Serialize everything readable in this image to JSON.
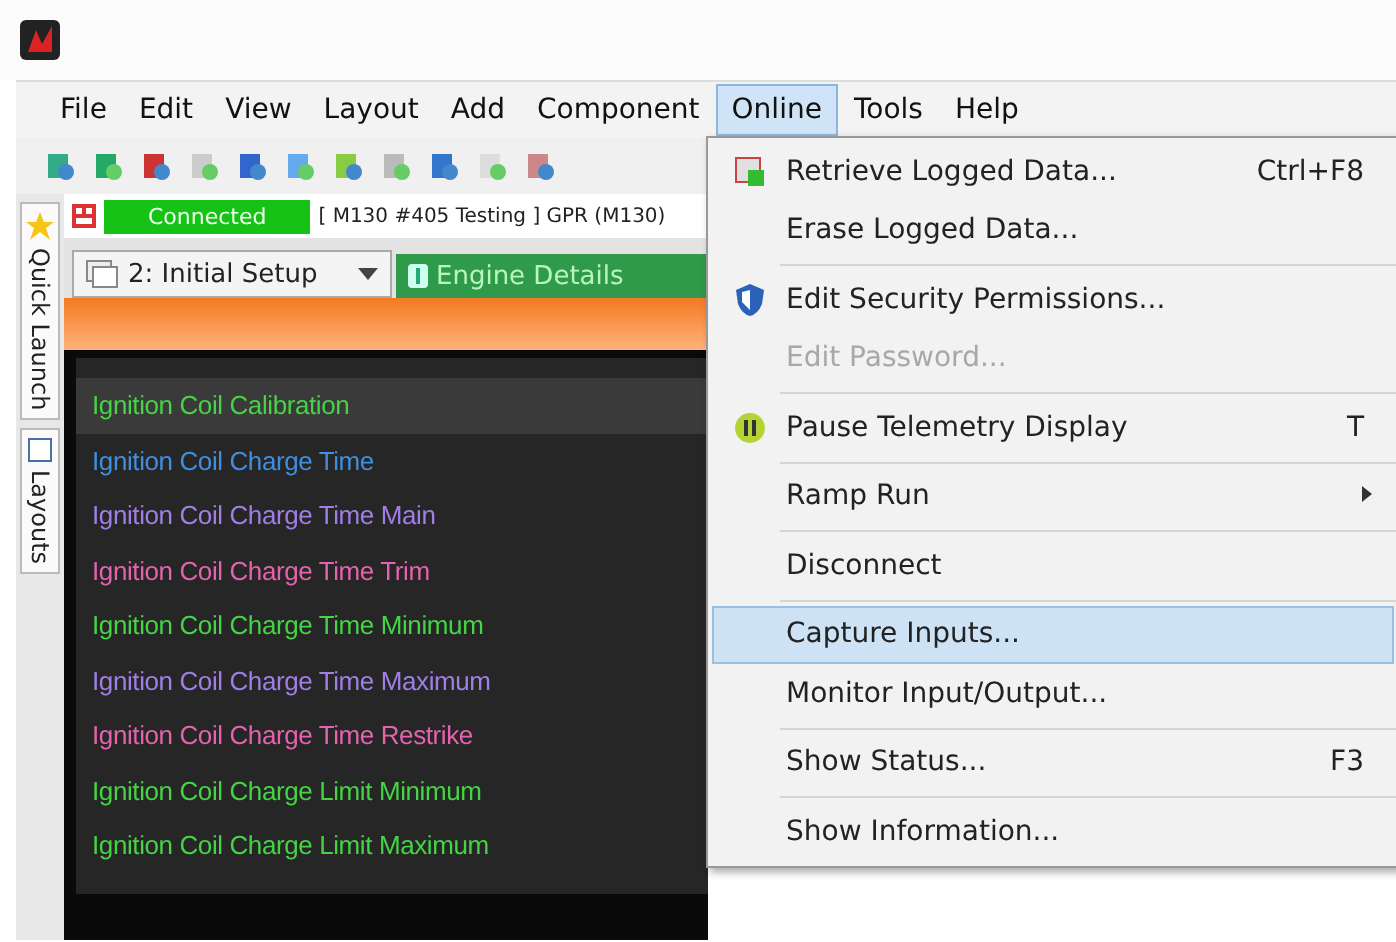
{
  "menu_bar": [
    {
      "label": "File",
      "selected": false
    },
    {
      "label": "Edit",
      "selected": false
    },
    {
      "label": "View",
      "selected": false
    },
    {
      "label": "Layout",
      "selected": false
    },
    {
      "label": "Add",
      "selected": false
    },
    {
      "label": "Component",
      "selected": false
    },
    {
      "label": "Online",
      "selected": true
    },
    {
      "label": "Tools",
      "selected": false
    },
    {
      "label": "Help",
      "selected": false
    }
  ],
  "side_tabs": [
    {
      "label": "Quick Launch",
      "kind": "star"
    },
    {
      "label": "Layouts",
      "kind": "square"
    }
  ],
  "connection": {
    "status": "Connected",
    "connected": true,
    "device": "[ M130 #405 Testing ]  GPR (M130)"
  },
  "workbook": {
    "value": "2: Initial Setup"
  },
  "tabs": [
    {
      "label": "Engine Details",
      "selected": true
    }
  ],
  "channels": [
    {
      "name": "Ignition Coil Calibration",
      "color": "#44d444",
      "selected": true
    },
    {
      "name": "Ignition Coil Charge Time",
      "color": "#3f8fe0",
      "selected": false
    },
    {
      "name": "Ignition Coil Charge Time Main",
      "color": "#a07ee6",
      "selected": false
    },
    {
      "name": "Ignition Coil Charge Time Trim",
      "color": "#e463ae",
      "selected": false
    },
    {
      "name": "Ignition Coil Charge Time Minimum",
      "color": "#44d444",
      "selected": false
    },
    {
      "name": "Ignition Coil Charge Time Maximum",
      "color": "#a07ee6",
      "selected": false
    },
    {
      "name": "Ignition Coil Charge Time Restrike",
      "color": "#e463ae",
      "selected": false
    },
    {
      "name": "Ignition Coil Charge Limit Minimum",
      "color": "#44d444",
      "selected": false
    },
    {
      "name": "Ignition Coil Charge Limit Maximum",
      "color": "#44d444",
      "selected": false
    }
  ],
  "online_menu": {
    "sections": [
      [
        {
          "label": "Retrieve Logged Data...",
          "shortcut": "Ctrl+F8",
          "kind": "download",
          "disabled": false,
          "selected": false,
          "submenu": false
        },
        {
          "label": "Erase Logged Data...",
          "kind": "plain",
          "disabled": false,
          "selected": false,
          "submenu": false
        }
      ],
      [
        {
          "label": "Edit Security Permissions...",
          "kind": "shield",
          "disabled": false,
          "selected": false,
          "submenu": false
        },
        {
          "label": "Edit Password...",
          "kind": "plain",
          "disabled": true,
          "selected": false,
          "submenu": false
        }
      ],
      [
        {
          "label": "Pause Telemetry Display",
          "shortcut": "T",
          "kind": "pause",
          "disabled": false,
          "selected": false,
          "submenu": false
        }
      ],
      [
        {
          "label": "Ramp Run",
          "kind": "plain",
          "disabled": false,
          "selected": false,
          "submenu": true
        }
      ],
      [
        {
          "label": "Disconnect",
          "kind": "plain",
          "disabled": false,
          "selected": false,
          "submenu": false
        }
      ],
      [
        {
          "label": "Capture Inputs...",
          "kind": "plain",
          "disabled": false,
          "selected": true,
          "submenu": false
        },
        {
          "label": "Monitor Input/Output...",
          "kind": "plain",
          "disabled": false,
          "selected": false,
          "submenu": false
        }
      ],
      [
        {
          "label": "Show Status...",
          "shortcut": "F3",
          "kind": "plain",
          "disabled": false,
          "selected": false,
          "submenu": false
        }
      ],
      [
        {
          "label": "Show Information...",
          "kind": "plain",
          "disabled": false,
          "selected": false,
          "submenu": false
        }
      ]
    ]
  }
}
